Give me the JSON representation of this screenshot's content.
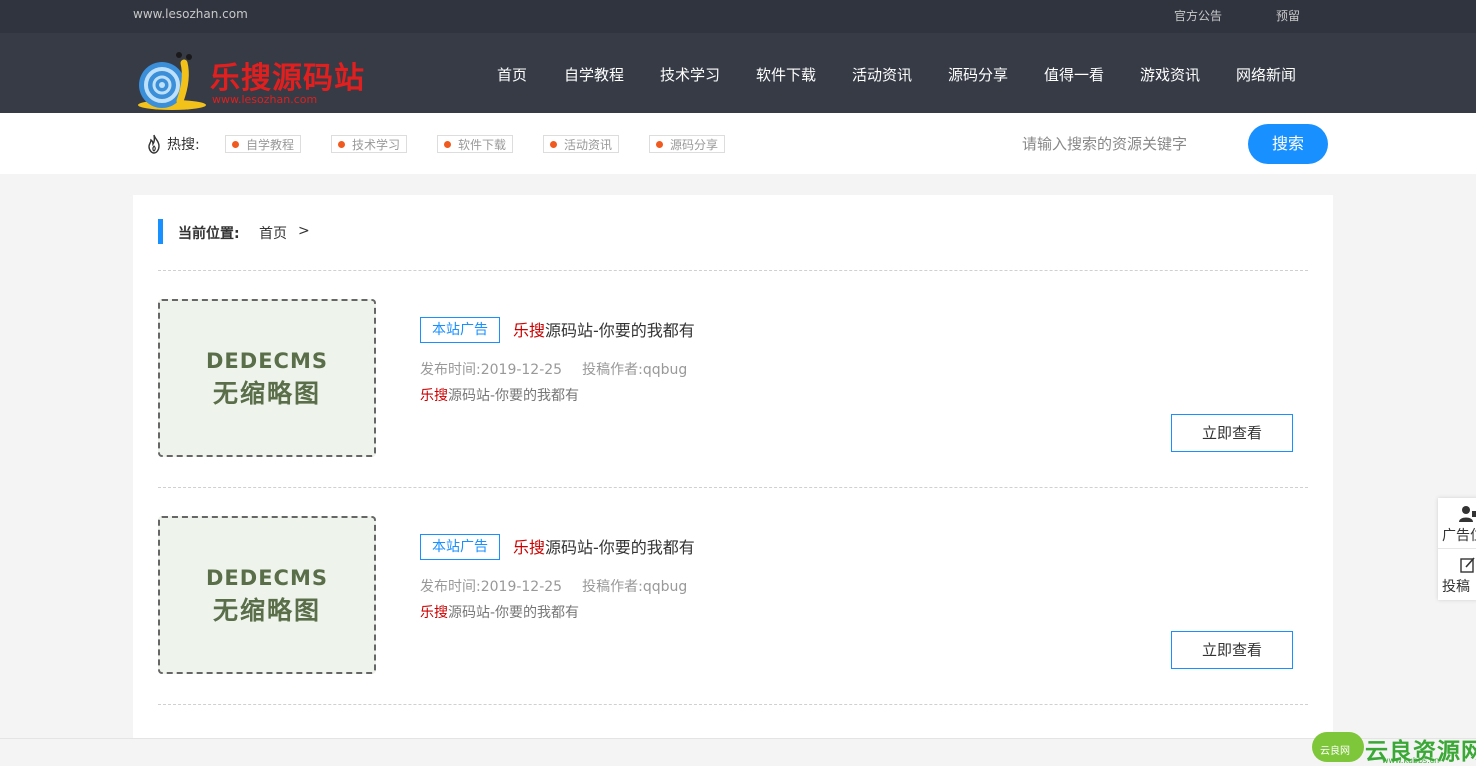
{
  "topbar": {
    "site_url": "www.lesozhan.com",
    "links": [
      "官方公告",
      "预留"
    ]
  },
  "header": {
    "logo_text": "乐搜源码站",
    "logo_sub": "www.lesozhan.com",
    "nav": [
      "首页",
      "自学教程",
      "技术学习",
      "软件下载",
      "活动资讯",
      "源码分享",
      "值得一看",
      "游戏资讯",
      "网络新闻"
    ]
  },
  "hot": {
    "label": "热搜:",
    "tags": [
      "自学教程",
      "技术学习",
      "软件下载",
      "活动资讯",
      "源码分享"
    ],
    "search_placeholder": "请输入搜索的资源关键字",
    "search_button": "搜索"
  },
  "breadcrumb": {
    "label": "当前位置:",
    "home": "首页",
    "separator": ">"
  },
  "articles": [
    {
      "thumb_line1": "DEDECMS",
      "thumb_line2": "无缩略图",
      "badge": "本站广告",
      "title_red": "乐搜",
      "title_rest": "源码站-你要的我都有",
      "publish_label": "发布时间:",
      "publish_date": "2019-12-25",
      "author_label": "投稿作者:",
      "author": "qqbug",
      "desc_red": "乐搜",
      "desc_rest": "源码站-你要的我都有",
      "button": "立即查看"
    },
    {
      "thumb_line1": "DEDECMS",
      "thumb_line2": "无缩略图",
      "badge": "本站广告",
      "title_red": "乐搜",
      "title_rest": "源码站-你要的我都有",
      "publish_label": "发布时间:",
      "publish_date": "2019-12-25",
      "author_label": "投稿作者:",
      "author": "qqbug",
      "desc_red": "乐搜",
      "desc_rest": "源码站-你要的我都有",
      "button": "立即查看"
    }
  ],
  "float_panel": {
    "items": [
      {
        "label": "广告位",
        "icon": "user-icon"
      },
      {
        "label": "投稿",
        "icon": "edit-icon"
      }
    ]
  },
  "watermark": {
    "small": "云良网",
    "big": "云良资源网",
    "url": "www.kubbs.cn"
  },
  "colors": {
    "topbar": "#30343f",
    "header": "#363b46",
    "accent": "#1890ff",
    "brand_red": "#e11f1f",
    "hot_dot": "#f05a1e"
  }
}
